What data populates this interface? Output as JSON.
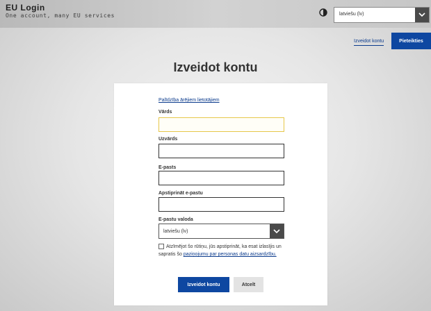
{
  "header": {
    "title": "EU Login",
    "subtitle": "One account, many EU services",
    "contrast_icon": "contrast-icon",
    "language_select": {
      "value": "latviešu (lv)",
      "icon": "chevron-down-icon"
    }
  },
  "nav": {
    "create_account_link": "Izveidot kontu",
    "login_button": "Pieteikties"
  },
  "page": {
    "title": "Izveidot kontu"
  },
  "form": {
    "help_link": "Palīdzība ārējiem lietotājiem",
    "fields": [
      {
        "label": "Vārds",
        "value": ""
      },
      {
        "label": "Uzvārds",
        "value": ""
      },
      {
        "label": "E-pasts",
        "value": ""
      },
      {
        "label": "Apstiprināt e-pastu",
        "value": ""
      }
    ],
    "email_language": {
      "label": "E-pastu valoda",
      "value": "latviešu (lv)"
    },
    "consent": {
      "text": "Atzīmējot šo rūtiņu, jūs apstiprināt, ka esat izlasījis un sapratis šo",
      "link": "paziņojumu par personas datu aizsardzību.",
      "checked": false
    },
    "submit_button": "Izveidot kontu",
    "cancel_button": "Atcelt"
  },
  "colors": {
    "primary": "#0e47a1",
    "focus_border": "#e6c74a"
  }
}
